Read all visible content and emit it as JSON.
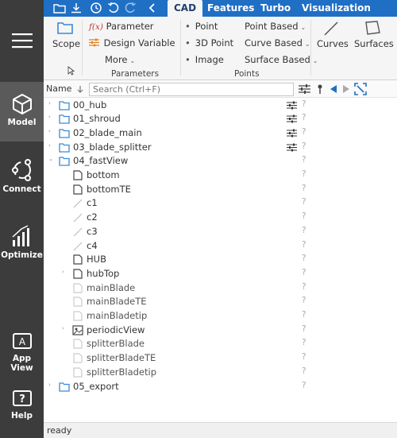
{
  "sidebar": {
    "items": [
      {
        "label": ""
      },
      {
        "label": "Model"
      },
      {
        "label": "Connect"
      },
      {
        "label": "Optimize"
      },
      {
        "label": "App View"
      },
      {
        "label": "Help"
      }
    ]
  },
  "tabs": [
    "CAD",
    "Features",
    "Turbo",
    "Visualization"
  ],
  "ribbon": {
    "scope": "Scope",
    "parameter": "Parameter",
    "design_variable": "Design Variable",
    "more": "More",
    "group_parameters": "Parameters",
    "point": "Point",
    "point3d": "3D Point",
    "image": "Image",
    "point_based": "Point Based",
    "curve_based": "Curve Based",
    "surface_based": "Surface Based",
    "group_points": "Points",
    "curves": "Curves",
    "surfaces": "Surfaces",
    "fx": "f(x)"
  },
  "treebar": {
    "name_label": "Name",
    "search_placeholder": "Search (Ctrl+F)"
  },
  "tree": {
    "rows": [
      {
        "name": "00_hub",
        "q": "?"
      },
      {
        "name": "01_shroud",
        "q": "?"
      },
      {
        "name": "02_blade_main",
        "q": "?"
      },
      {
        "name": "03_blade_splitter",
        "q": "?"
      },
      {
        "name": "04_fastView",
        "q": "?"
      },
      {
        "name": "bottom",
        "q": "?"
      },
      {
        "name": "bottomTE",
        "q": "?"
      },
      {
        "name": "c1",
        "q": "?"
      },
      {
        "name": "c2",
        "q": "?"
      },
      {
        "name": "c3",
        "q": "?"
      },
      {
        "name": "c4",
        "q": "?"
      },
      {
        "name": "HUB",
        "q": "?"
      },
      {
        "name": "hubTop",
        "q": "?"
      },
      {
        "name": "mainBlade",
        "q": "?"
      },
      {
        "name": "mainBladeTE",
        "q": "?"
      },
      {
        "name": "mainBladetip",
        "q": "?"
      },
      {
        "name": "periodicView",
        "q": "?"
      },
      {
        "name": "splitterBlade",
        "q": "?"
      },
      {
        "name": "splitterBladeTE",
        "q": "?"
      },
      {
        "name": "splitterBladetip",
        "q": "?"
      },
      {
        "name": "05_export",
        "q": "?"
      }
    ]
  },
  "status": {
    "text": "ready"
  },
  "colors": {
    "accent": "#1f6fc5",
    "sidebar": "#3c3c3c",
    "folder": "#3a8ad8"
  }
}
